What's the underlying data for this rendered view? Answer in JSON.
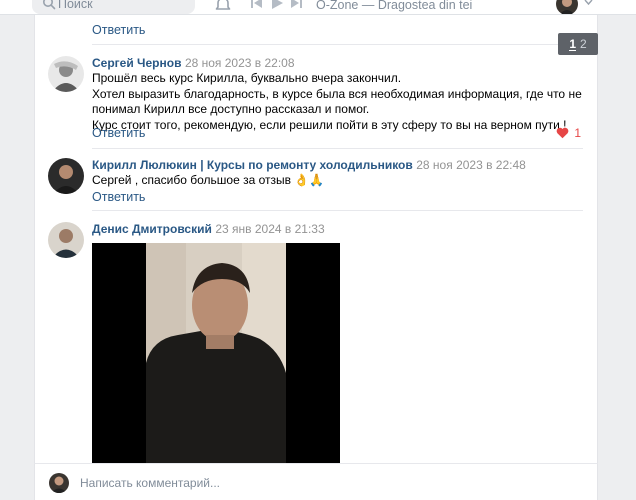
{
  "header": {
    "search_placeholder": "Поиск",
    "now_playing": "O-Zone — Dragostea din tei"
  },
  "pagination": {
    "current": "1",
    "other": "2"
  },
  "top_reply": "Ответить",
  "comments": [
    {
      "author": "Сергей Чернов",
      "date": "28 ноя 2023 в 22:08",
      "lines": [
        "Прошёл весь курс Кирилла, буквально вчера закончил.",
        "Хотел выразить благодарность, в курсе была вся необходимая информация, где что не понимал Кирилл все доступно рассказал и помог.",
        "Курс стоит того, рекомендую, если решили пойти в эту сферу то вы на верном пути !"
      ],
      "reply": "Ответить",
      "likes": "1"
    },
    {
      "author": "Кирилл Люлюкин | Курсы по ремонту холодильников",
      "date": "28 ноя 2023 в 22:48",
      "lines": [
        "Сергей , спасибо большое за отзыв 👌🙏"
      ],
      "reply": "Ответить"
    },
    {
      "author": "Денис Дмитровский",
      "date": "23 янв 2024 в 21:33"
    }
  ],
  "composer": {
    "placeholder": "Написать комментарий..."
  },
  "colors": {
    "link": "#2a5885",
    "like": "#e64646",
    "muted": "#939393",
    "background": "#edeef0"
  }
}
